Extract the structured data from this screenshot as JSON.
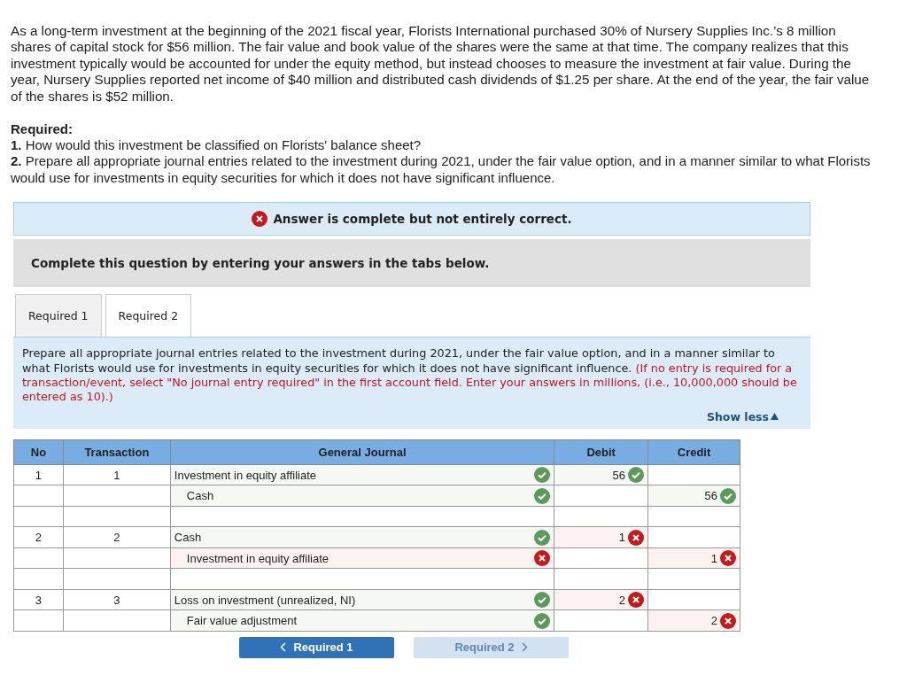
{
  "question": "As a long-term investment at the beginning of the 2021 fiscal year, Florists International purchased 30% of Nursery Supplies Inc.’s 8 million shares of capital stock for $56 million. The fair value and book value of the shares were the same at that time. The company realizes that this investment typically would be accounted for under the equity method, but instead chooses to measure the investment at fair value. During the year, Nursery Supplies reported net income of $40 million and distributed cash dividends of $1.25 per share. At the end of the year, the fair value of the shares is $52 million.",
  "required_heading": "Required:",
  "requirements": [
    {
      "number": "1.",
      "text": "How would this investment be classified on Florists' balance sheet?"
    },
    {
      "number": "2.",
      "text": "Prepare all appropriate journal entries related to the investment during 2021, under the fair value option, and in a manner similar to what Florists would use for investments in equity securities for which it does not have significant influence."
    }
  ],
  "result_banner": {
    "correct": false,
    "text": "Answer is complete but not entirely correct."
  },
  "instruction_banner": "Complete this question by entering your answers in the tabs below.",
  "tabs": [
    {
      "label": "Required 1",
      "selected": false
    },
    {
      "label": "Required 2",
      "selected": true
    }
  ],
  "tab_instructions": "Prepare all appropriate journal entries related to the investment during 2021, under the fair value option, and in a manner similar to what Florists would use for investments in equity securities for which it does not have significant influence.",
  "tab_note": "(If no entry is required for a transaction/event, select \"No journal entry required\" in the first account field. Enter your answers in millions, (i.e., 10,000,000 should be entered as 10).)",
  "show_less": "Show less",
  "journal": {
    "columns": [
      "No",
      "Transaction",
      "General Journal",
      "Debit",
      "Credit"
    ],
    "rows": [
      {
        "no": "1",
        "transaction": "1",
        "account": {
          "text": "Investment in equity affiliate",
          "indent": false,
          "correct": true
        },
        "debit": {
          "value": "56",
          "correct": true
        }
      },
      {
        "account": {
          "text": "Cash",
          "indent": true,
          "correct": true
        },
        "credit": {
          "value": "56",
          "correct": true
        }
      },
      {},
      {
        "no": "2",
        "transaction": "2",
        "account": {
          "text": "Cash",
          "indent": false,
          "correct": true
        },
        "debit": {
          "value": "1",
          "correct": false
        }
      },
      {
        "account": {
          "text": "Investment in equity affiliate",
          "indent": true,
          "correct": false
        },
        "credit": {
          "value": "1",
          "correct": false
        }
      },
      {},
      {
        "no": "3",
        "transaction": "3",
        "account": {
          "text": "Loss on investment (unrealized, NI)",
          "indent": false,
          "correct": true
        },
        "debit": {
          "value": "2",
          "correct": false
        }
      },
      {
        "account": {
          "text": "Fair value adjustment",
          "indent": true,
          "correct": true
        },
        "credit": {
          "value": "2",
          "correct": false
        }
      }
    ]
  },
  "nav_buttons": [
    {
      "label": "Required 1",
      "kind": "prev",
      "disabled": false
    },
    {
      "label": "Required 2",
      "kind": "next",
      "disabled": true
    }
  ]
}
